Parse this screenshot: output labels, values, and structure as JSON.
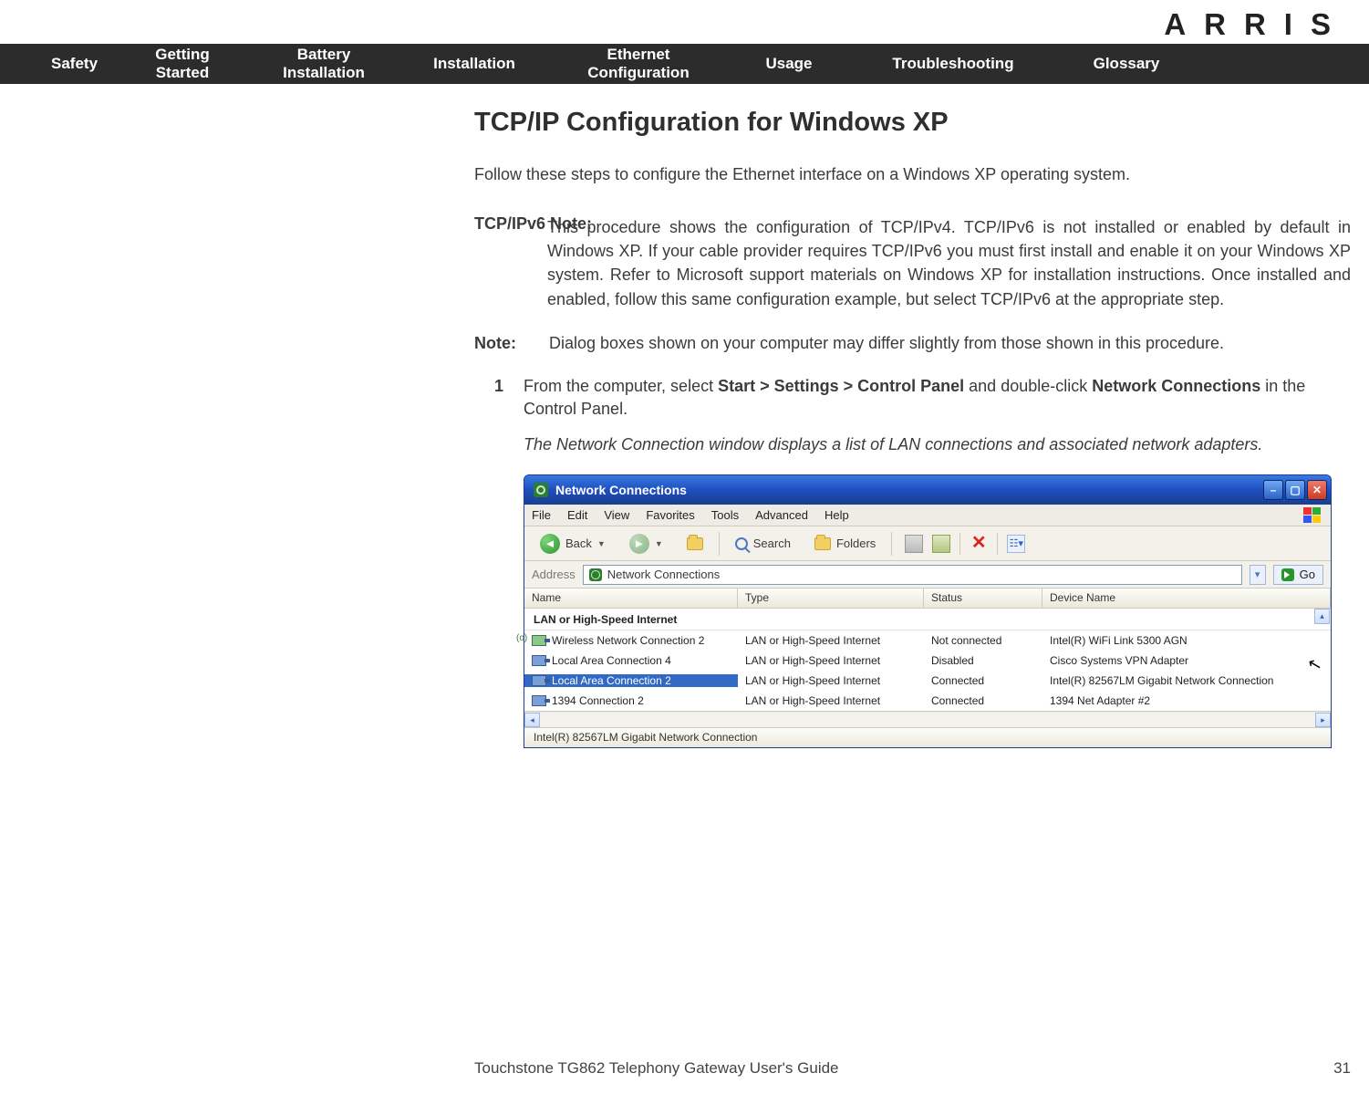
{
  "brand": "ARRIS",
  "nav": {
    "safety": "Safety",
    "getting_started_l1": "Getting",
    "getting_started_l2": "Started",
    "battery_l1": "Battery",
    "battery_l2": "Installation",
    "installation": "Installation",
    "ethernet_l1": "Ethernet",
    "ethernet_l2": "Configuration",
    "usage": "Usage",
    "troubleshooting": "Troubleshooting",
    "glossary": "Glossary"
  },
  "heading": "TCP/IP Configuration for Windows XP",
  "intro": "Follow these steps to configure the Ethernet interface on a Windows XP operating system.",
  "note1_label": "TCP/IPv6 Note:",
  "note1_body": "This procedure shows the configuration of TCP/IPv4.  TCP/IPv6 is not installed or enabled by default in Windows XP.  If your cable provider requires TCP/IPv6 you must first install and enable it on your Windows XP system.  Refer to Microsoft support materials on Windows XP for installation instructions.  Once installed and enabled, follow this same configuration example, but select TCP/IPv6 at the appropriate step.",
  "note2_label": "Note:",
  "note2_body": "Dialog boxes shown on your computer may differ slightly from those shown in this procedure.",
  "step1_num": "1",
  "step1_a": "From the computer, select ",
  "step1_b": "Start > Settings > Control Panel",
  "step1_c": " and double-click ",
  "step1_d": "Network Connections",
  "step1_e": " in the Control Panel.",
  "step1_result": "The Network Connection window displays a list of LAN connections and associated network adapters.",
  "xp": {
    "title": "Network Connections",
    "menu": {
      "file": "File",
      "edit": "Edit",
      "view": "View",
      "favorites": "Favorites",
      "tools": "Tools",
      "advanced": "Advanced",
      "help": "Help"
    },
    "toolbar": {
      "back": "Back",
      "search": "Search",
      "folders": "Folders"
    },
    "address_label": "Address",
    "address_value": "Network Connections",
    "go": "Go",
    "columns": {
      "name": "Name",
      "type": "Type",
      "status": "Status",
      "device": "Device Name"
    },
    "group": "LAN or High-Speed Internet",
    "rows": [
      {
        "name": "Wireless Network Connection 2",
        "type": "LAN or High-Speed Internet",
        "status": "Not connected",
        "device": "Intel(R) WiFi Link 5300 AGN",
        "wifi": true
      },
      {
        "name": "Local Area Connection 4",
        "type": "LAN or High-Speed Internet",
        "status": "Disabled",
        "device": "Cisco Systems VPN Adapter"
      },
      {
        "name": "Local Area Connection 2",
        "type": "LAN or High-Speed Internet",
        "status": "Connected",
        "device": "Intel(R) 82567LM Gigabit Network Connection",
        "selected": true
      },
      {
        "name": "1394 Connection 2",
        "type": "LAN or High-Speed Internet",
        "status": "Connected",
        "device": "1394 Net Adapter #2"
      }
    ],
    "statusbar": "Intel(R) 82567LM Gigabit Network Connection"
  },
  "footer_title": "Touchstone TG862 Telephony Gateway User's Guide",
  "footer_page": "31"
}
